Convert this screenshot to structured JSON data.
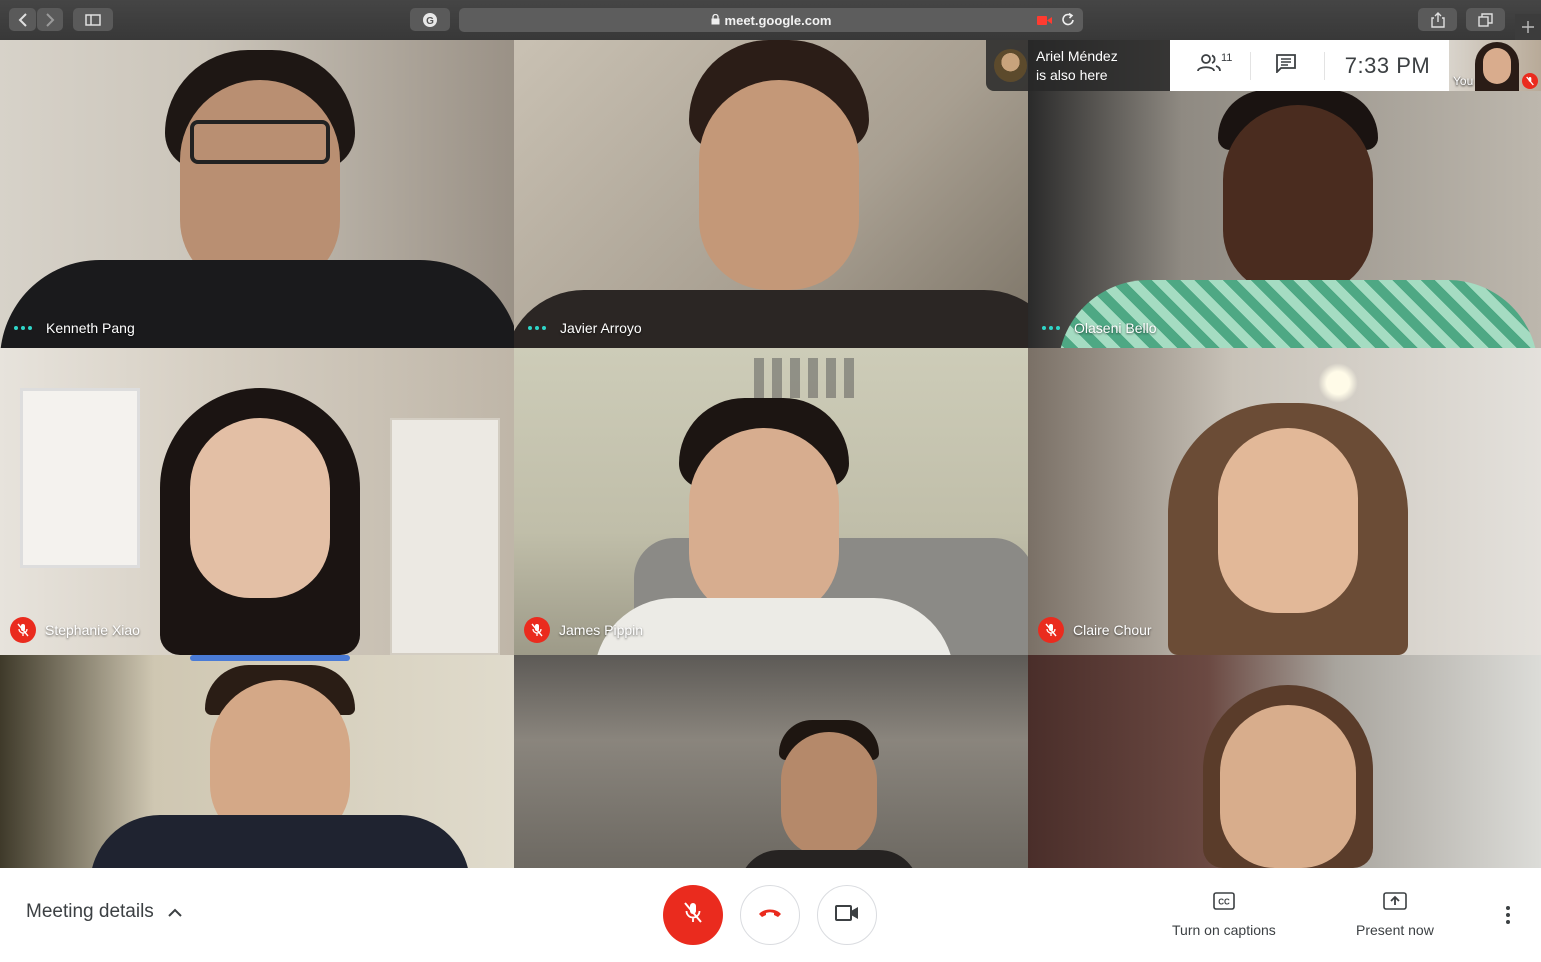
{
  "browser": {
    "url": "meet.google.com"
  },
  "participants": [
    {
      "name": "Kenneth Pang",
      "status": "speaking"
    },
    {
      "name": "Javier Arroyo",
      "status": "speaking"
    },
    {
      "name": "Olaseni Bello",
      "status": "speaking"
    },
    {
      "name": "Stephanie Xiao",
      "status": "muted"
    },
    {
      "name": "James Pippin",
      "status": "muted"
    },
    {
      "name": "Claire Chour",
      "status": "muted"
    },
    {
      "name": "",
      "status": "none"
    },
    {
      "name": "",
      "status": "none"
    },
    {
      "name": "",
      "status": "none"
    }
  ],
  "notification": {
    "line1": "Ariel Méndez",
    "line2": "is also here"
  },
  "top_toolbar": {
    "people_count": "11",
    "time": "7:33 PM",
    "self_label": "You"
  },
  "bottom_bar": {
    "meeting_details": "Meeting details",
    "captions_label": "Turn on captions",
    "present_label": "Present now"
  },
  "colors": {
    "accent_red": "#ea2b1e",
    "speaking_dots": "#2fd5c8"
  },
  "icons": [
    "back-icon",
    "forward-icon",
    "sidebar-icon",
    "extension-icon",
    "lock-icon",
    "camera-recording-icon",
    "reload-icon",
    "share-icon",
    "tabs-icon",
    "new-tab-icon",
    "people-icon",
    "chat-icon",
    "mic-off-icon",
    "hang-up-icon",
    "camera-icon",
    "captions-icon",
    "present-icon",
    "more-vert-icon",
    "chevron-up-icon"
  ]
}
